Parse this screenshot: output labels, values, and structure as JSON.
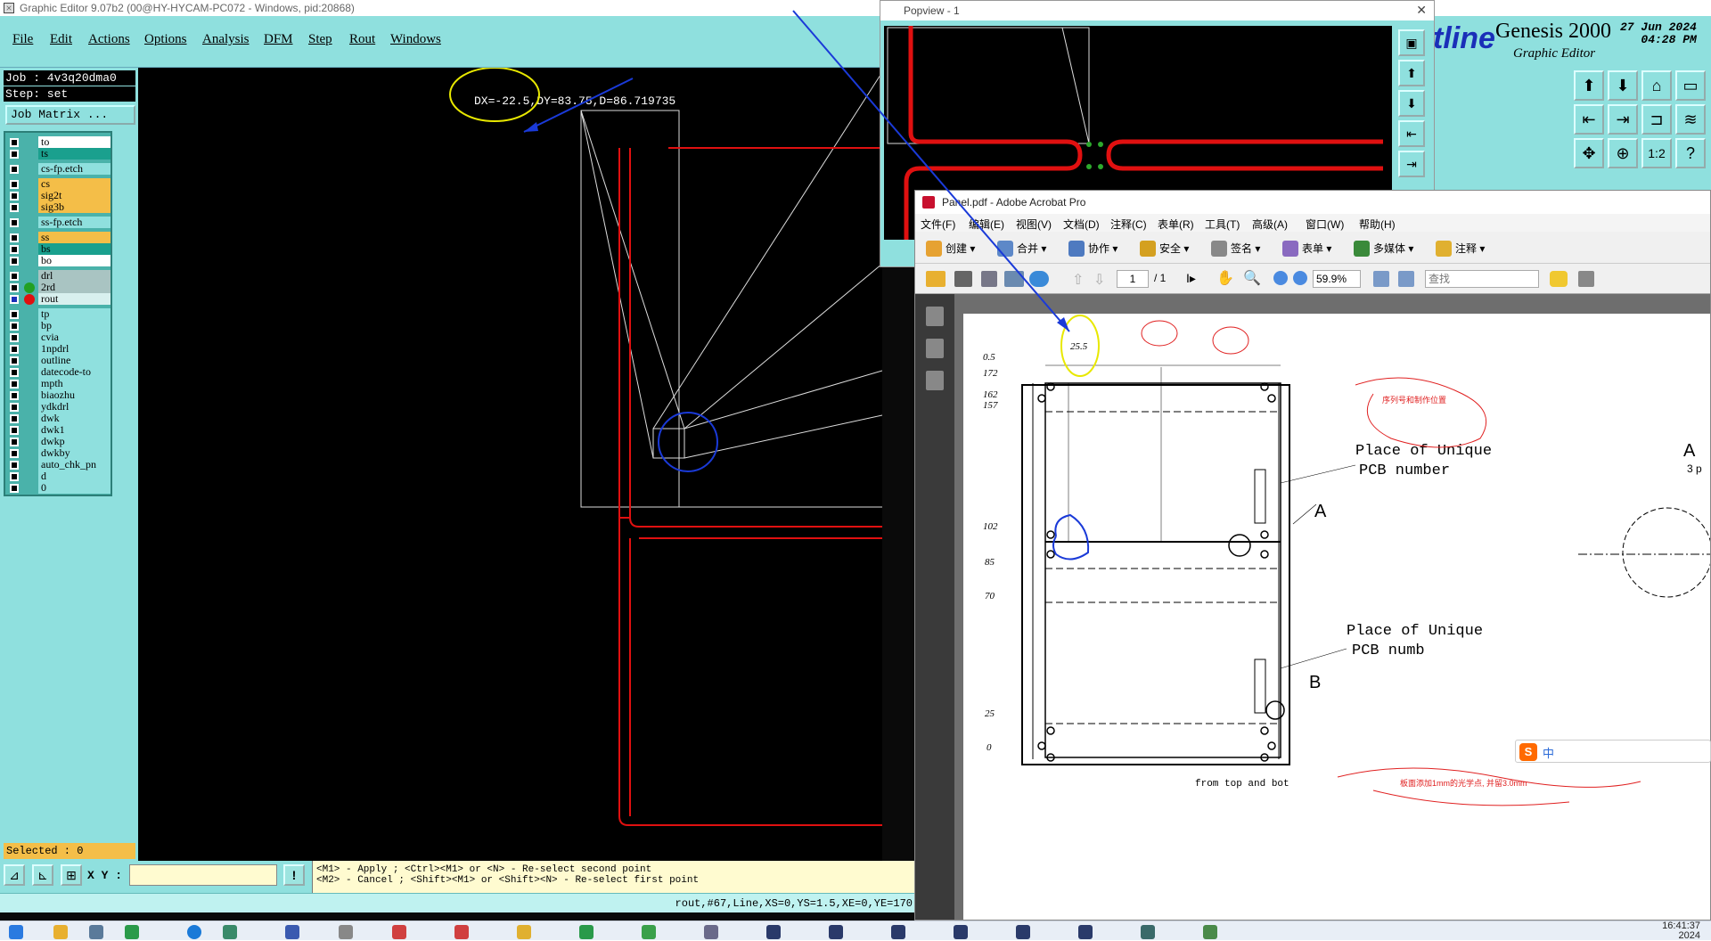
{
  "graphic_editor": {
    "title": "Graphic Editor 9.07b2 (00@HY-HYCAM-PC072 - Windows, pid:20868)",
    "menu": [
      "File",
      "Edit",
      "Actions",
      "Options",
      "Analysis",
      "DFM",
      "Step",
      "Rout",
      "Windows"
    ],
    "job": "Job : 4v3q20dma0",
    "step": "Step: set",
    "job_matrix": "Job Matrix ...",
    "layers": [
      {
        "name": "to",
        "color": "#ffffff"
      },
      {
        "name": "ts",
        "color": "#1aa08e"
      },
      {
        "name": "cs-fp.etch",
        "color": "#8fe0de"
      },
      {
        "name": "cs",
        "color": "#f4be48"
      },
      {
        "name": "sig2t",
        "color": "#f4be48"
      },
      {
        "name": "sig3b",
        "color": "#f4be48"
      },
      {
        "name": "ss-fp.etch",
        "color": "#8fe0de"
      },
      {
        "name": "ss",
        "color": "#f4be48"
      },
      {
        "name": "bs",
        "color": "#1aa08e"
      },
      {
        "name": "bo",
        "color": "#ffffff"
      },
      {
        "name": "drl",
        "color": "#a9c4c2"
      },
      {
        "name": "2rd",
        "color": "#a9c4c2"
      },
      {
        "name": "rout",
        "color": "#d8f0ee"
      },
      {
        "name": "tp",
        "color": "#8fe0de"
      },
      {
        "name": "bp",
        "color": "#8fe0de"
      },
      {
        "name": "cvia",
        "color": "#8fe0de"
      },
      {
        "name": "1npdrl",
        "color": "#8fe0de"
      },
      {
        "name": "outline",
        "color": "#8fe0de"
      },
      {
        "name": "datecode-to",
        "color": "#8fe0de"
      },
      {
        "name": "mpth",
        "color": "#8fe0de"
      },
      {
        "name": "biaozhu",
        "color": "#8fe0de"
      },
      {
        "name": "ydkdrl",
        "color": "#8fe0de"
      },
      {
        "name": "dwk",
        "color": "#8fe0de"
      },
      {
        "name": "dwk1",
        "color": "#8fe0de"
      },
      {
        "name": "dwkp",
        "color": "#8fe0de"
      },
      {
        "name": "dwkby",
        "color": "#8fe0de"
      },
      {
        "name": "auto_chk_pn",
        "color": "#8fe0de"
      },
      {
        "name": "d",
        "color": "#8fe0de"
      },
      {
        "name": "0",
        "color": "#8fe0de"
      }
    ],
    "measure_text": "DX=-22.5,DY=83.75,D=86.719735",
    "selected": "Selected : 0",
    "xy_label": "X Y :",
    "xy_value": "",
    "hint_line1": "<M1> - Apply  ; <Ctrl><M1> or <N> - Re-select second point",
    "hint_line2": "<M2> - Cancel ; <Shift><M1> or <Shift><N> - Re-select first point",
    "status": "rout,#67,Line,XS=0,YS=1.5,XE=0,YE=170",
    "brand": "tline",
    "product": "Genesis 2000",
    "subtitle": "Graphic Editor",
    "date": "27 Jun 2024",
    "time": "04:28 PM"
  },
  "popview": {
    "title": "Popview - 1"
  },
  "acrobat": {
    "title": "Panel.pdf - Adobe Acrobat Pro",
    "menu": [
      "文件(F)",
      "编辑(E)",
      "视图(V)",
      "文档(D)",
      "注释(C)",
      "表单(R)",
      "工具(T)",
      "高级(A)",
      "窗口(W)",
      "帮助(H)"
    ],
    "toolbar": [
      "创建",
      "合并",
      "协作",
      "安全",
      "签名",
      "表单",
      "多媒体",
      "注释"
    ],
    "page": "1",
    "page_total": "/ 1",
    "zoom": "59.9%",
    "search_placeholder": "查找",
    "drawing": {
      "dim_top": "25.5",
      "dim_top_left": "0.5",
      "dim_left": [
        "172",
        "162",
        "157",
        "102",
        "85",
        "70",
        "25",
        "0"
      ],
      "place_label_1a": "Place of Unique",
      "place_label_1b": "PCB number",
      "place_label_2a": "Place of Unique",
      "place_label_2b": "PCB numb",
      "marker_a": "A",
      "marker_b": "B",
      "marker_a_right": "A",
      "marker_a_right_sub": "3 p",
      "bottom_note": "from top and bot",
      "red_note_top": "序列号和制作位置",
      "red_note_bottom": "板面添加1mm的光学点, 并留3.0mm"
    }
  },
  "ime": {
    "label": "中"
  },
  "taskbar": {
    "time": "16:41:37",
    "date": "2024"
  }
}
